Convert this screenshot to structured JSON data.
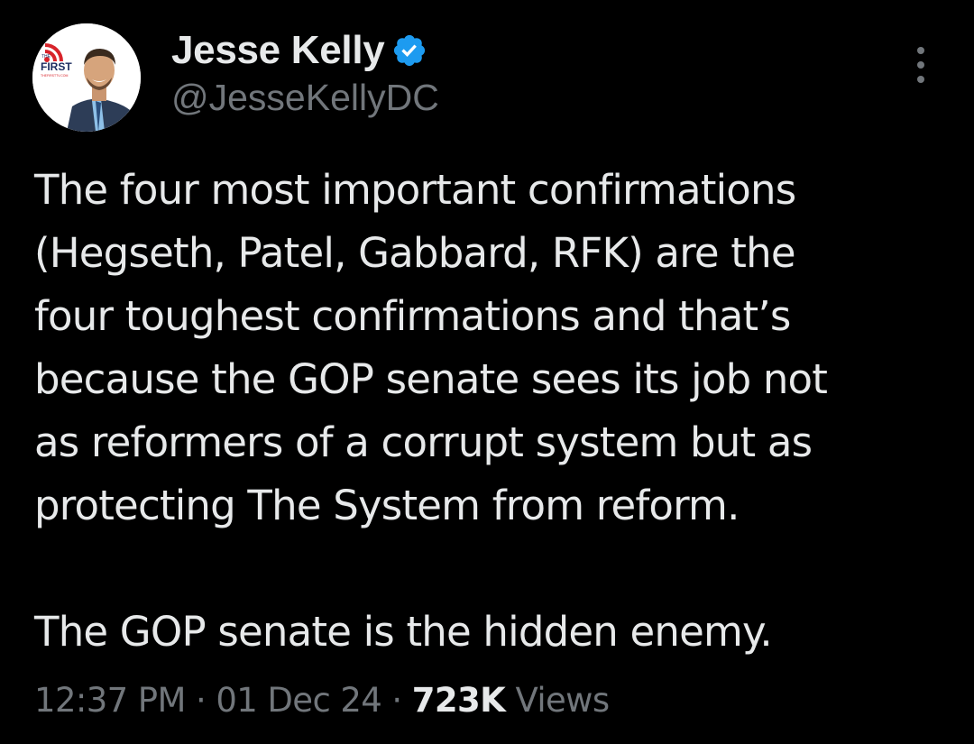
{
  "author": {
    "display_name": "Jesse Kelly",
    "handle": "@JesseKellyDC",
    "avatar_badge": {
      "small_text": "THE",
      "logo_text": "FIRST",
      "sub_text": "THEFIRSTTV.COM"
    },
    "verified_icon": "verified-badge-icon",
    "verified_color": "#1d9bf0"
  },
  "more_icon": "more-options-icon",
  "tweet": {
    "lines": [
      "The four most important confirmations",
      "(Hegseth, Patel, Gabbard, RFK) are the",
      "four toughest confirmations and that’s",
      "because the GOP senate sees its job not",
      "as reformers of a corrupt system but as",
      "protecting The System from reform."
    ],
    "closing_line": "The GOP senate is the hidden enemy."
  },
  "meta": {
    "time": "12:37 PM",
    "separator": "·",
    "date": "01 Dec 24",
    "views_count": "723K",
    "views_label": "Views"
  },
  "colors": {
    "background": "#000000",
    "text": "#e7e9ea",
    "secondary": "#71767b"
  }
}
